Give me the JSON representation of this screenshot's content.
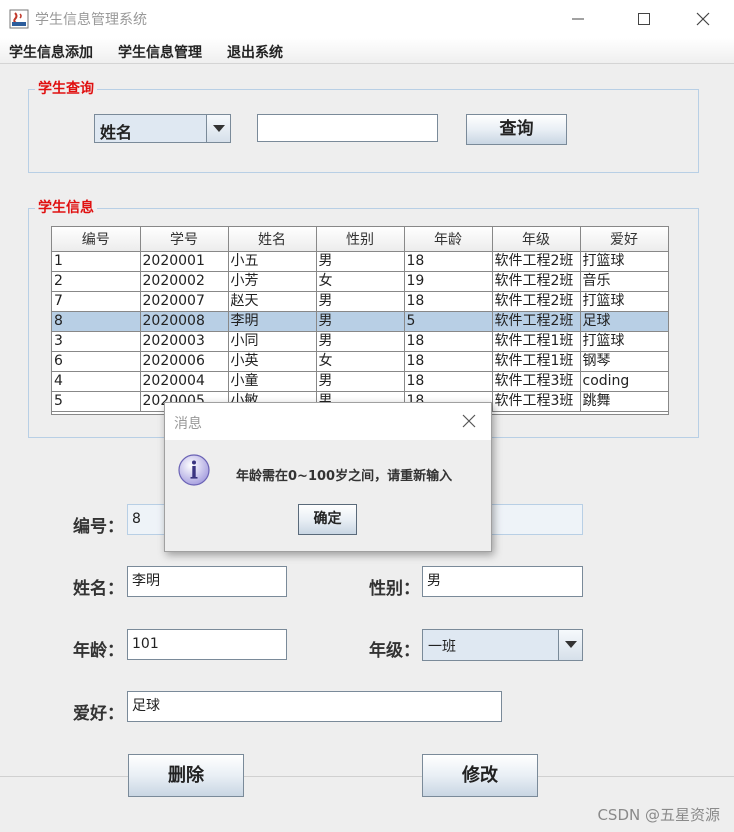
{
  "window": {
    "title": "学生信息管理系统"
  },
  "menu": {
    "items": [
      "学生信息添加",
      "学生信息管理",
      "退出系统"
    ]
  },
  "query": {
    "group_title": "学生查询",
    "field_selected": "姓名",
    "search_value": "",
    "button_label": "查询"
  },
  "info": {
    "group_title": "学生信息",
    "columns": [
      "编号",
      "学号",
      "姓名",
      "性别",
      "年龄",
      "年级",
      "爱好"
    ],
    "rows": [
      [
        "1",
        "2020001",
        "小五",
        "男",
        "18",
        "软件工程2班",
        "打篮球"
      ],
      [
        "2",
        "2020002",
        "小芳",
        "女",
        "19",
        "软件工程2班",
        "音乐"
      ],
      [
        "7",
        "2020007",
        "赵天",
        "男",
        "18",
        "软件工程2班",
        "打篮球"
      ],
      [
        "8",
        "2020008",
        "李明",
        "男",
        "5",
        "软件工程2班",
        "足球"
      ],
      [
        "3",
        "2020003",
        "小同",
        "男",
        "18",
        "软件工程1班",
        "打篮球"
      ],
      [
        "6",
        "2020006",
        "小英",
        "女",
        "18",
        "软件工程1班",
        "钢琴"
      ],
      [
        "4",
        "2020004",
        "小童",
        "男",
        "18",
        "软件工程3班",
        "coding"
      ],
      [
        "5",
        "2020005",
        "小敏",
        "男",
        "18",
        "软件工程3班",
        "跳舞"
      ]
    ],
    "selected_row": 3
  },
  "form": {
    "id_label": "编号：",
    "id_value": "8",
    "name_label": "姓名：",
    "name_value": "李明",
    "gender_label": "性别：",
    "gender_value": "男",
    "age_label": "年龄：",
    "age_value": "101",
    "grade_label": "年级：",
    "grade_value": "一班",
    "hobby_label": "爱好：",
    "hobby_value": "足球",
    "delete_label": "删除",
    "modify_label": "修改"
  },
  "dialog": {
    "title": "消息",
    "message": "年龄需在0~100岁之间，请重新输入",
    "ok_label": "确定"
  },
  "watermark": "CSDN @五星资源"
}
